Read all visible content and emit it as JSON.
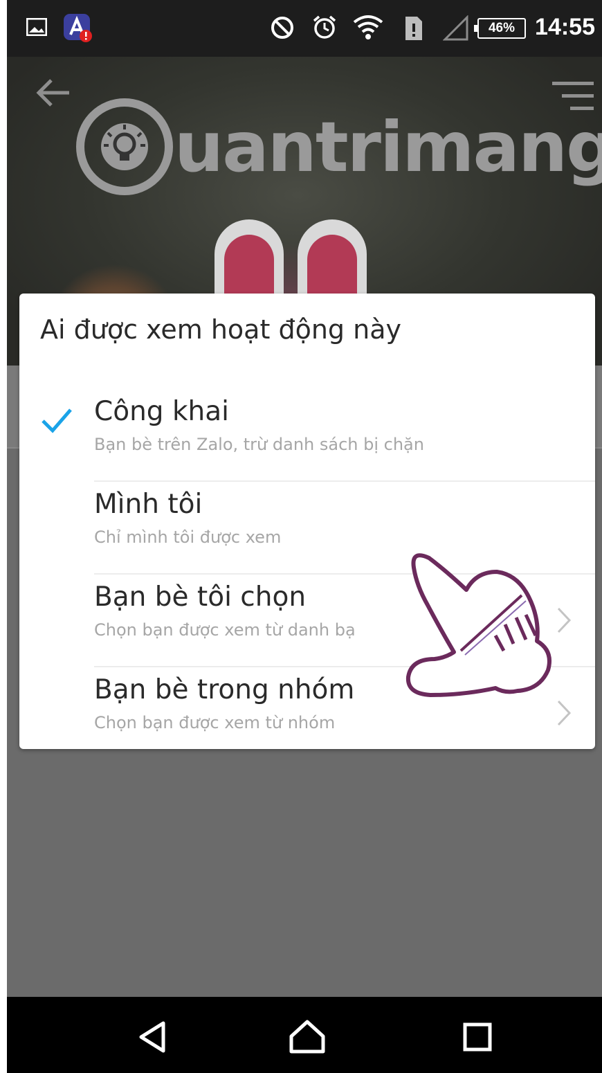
{
  "status_bar": {
    "time": "14:55",
    "battery": "46%",
    "icons": [
      "image-notification-icon",
      "app-alert-icon",
      "do-not-disturb-icon",
      "alarm-icon",
      "wifi-icon",
      "sim-icon",
      "signal-icon",
      "battery-icon"
    ]
  },
  "header": {
    "brand": "uantrimang",
    "icons": [
      "back-arrow-icon",
      "menu-icon"
    ]
  },
  "dialog": {
    "title": "Ai được xem hoạt động này",
    "options": [
      {
        "label": "Công khai",
        "sub": "Bạn bè trên Zalo, trừ danh sách bị chặn",
        "selected": true,
        "has_chevron": false
      },
      {
        "label": "Mình tôi",
        "sub": "Chỉ mình tôi được xem",
        "selected": false,
        "has_chevron": false
      },
      {
        "label": "Bạn bè tôi chọn",
        "sub": "Chọn bạn được xem từ danh bạ",
        "selected": false,
        "has_chevron": true
      },
      {
        "label": "Bạn bè trong nhóm",
        "sub": "Chọn bạn được xem từ nhóm",
        "selected": false,
        "has_chevron": true
      }
    ]
  },
  "navbar": {
    "icons": [
      "back-triangle-icon",
      "home-icon",
      "recents-icon"
    ]
  },
  "colors": {
    "check": "#1aa3e8",
    "dim_background": "#6b6b6b",
    "hand_outline": "#6b2a5c"
  }
}
